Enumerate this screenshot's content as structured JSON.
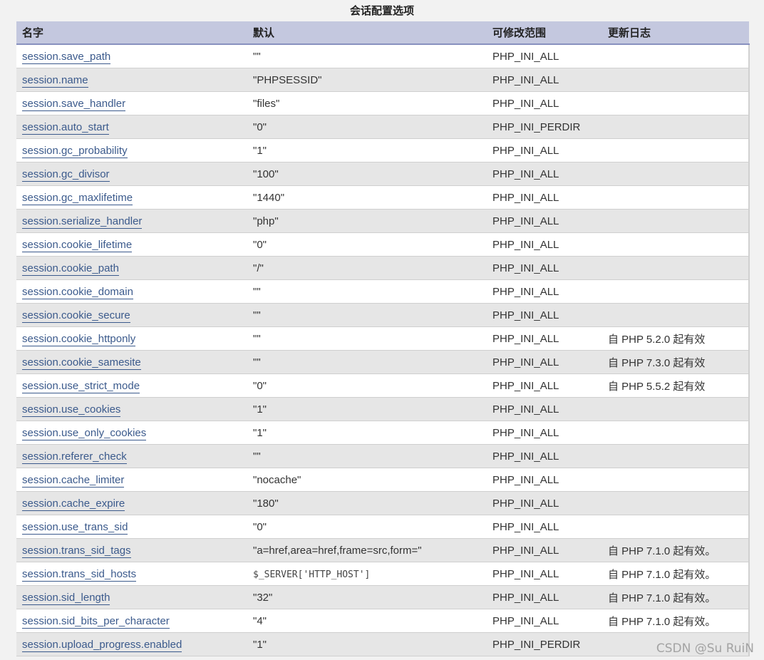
{
  "caption": "会话配置选项",
  "table": {
    "headers": [
      "名字",
      "默认",
      "可修改范围",
      "更新日志"
    ],
    "rows": [
      {
        "name": "session.save_path",
        "default": "\"\"",
        "scope": "PHP_INI_ALL",
        "changelog": ""
      },
      {
        "name": "session.name",
        "default": "\"PHPSESSID\"",
        "scope": "PHP_INI_ALL",
        "changelog": ""
      },
      {
        "name": "session.save_handler",
        "default": "\"files\"",
        "scope": "PHP_INI_ALL",
        "changelog": ""
      },
      {
        "name": "session.auto_start",
        "default": "\"0\"",
        "scope": "PHP_INI_PERDIR",
        "changelog": ""
      },
      {
        "name": "session.gc_probability",
        "default": "\"1\"",
        "scope": "PHP_INI_ALL",
        "changelog": ""
      },
      {
        "name": "session.gc_divisor",
        "default": "\"100\"",
        "scope": "PHP_INI_ALL",
        "changelog": ""
      },
      {
        "name": "session.gc_maxlifetime",
        "default": "\"1440\"",
        "scope": "PHP_INI_ALL",
        "changelog": ""
      },
      {
        "name": "session.serialize_handler",
        "default": "\"php\"",
        "scope": "PHP_INI_ALL",
        "changelog": ""
      },
      {
        "name": "session.cookie_lifetime",
        "default": "\"0\"",
        "scope": "PHP_INI_ALL",
        "changelog": ""
      },
      {
        "name": "session.cookie_path",
        "default": "\"/\"",
        "scope": "PHP_INI_ALL",
        "changelog": ""
      },
      {
        "name": "session.cookie_domain",
        "default": "\"\"",
        "scope": "PHP_INI_ALL",
        "changelog": ""
      },
      {
        "name": "session.cookie_secure",
        "default": "\"\"",
        "scope": "PHP_INI_ALL",
        "changelog": ""
      },
      {
        "name": "session.cookie_httponly",
        "default": "\"\"",
        "scope": "PHP_INI_ALL",
        "changelog": "自 PHP 5.2.0 起有效"
      },
      {
        "name": "session.cookie_samesite",
        "default": "\"\"",
        "scope": "PHP_INI_ALL",
        "changelog": "自 PHP 7.3.0 起有效"
      },
      {
        "name": "session.use_strict_mode",
        "default": "\"0\"",
        "scope": "PHP_INI_ALL",
        "changelog": "自 PHP 5.5.2 起有效"
      },
      {
        "name": "session.use_cookies",
        "default": "\"1\"",
        "scope": "PHP_INI_ALL",
        "changelog": ""
      },
      {
        "name": "session.use_only_cookies",
        "default": "\"1\"",
        "scope": "PHP_INI_ALL",
        "changelog": ""
      },
      {
        "name": "session.referer_check",
        "default": "\"\"",
        "scope": "PHP_INI_ALL",
        "changelog": ""
      },
      {
        "name": "session.cache_limiter",
        "default": "\"nocache\"",
        "scope": "PHP_INI_ALL",
        "changelog": ""
      },
      {
        "name": "session.cache_expire",
        "default": "\"180\"",
        "scope": "PHP_INI_ALL",
        "changelog": ""
      },
      {
        "name": "session.use_trans_sid",
        "default": "\"0\"",
        "scope": "PHP_INI_ALL",
        "changelog": ""
      },
      {
        "name": "session.trans_sid_tags",
        "default": "\"a=href,area=href,frame=src,form=\"",
        "scope": "PHP_INI_ALL",
        "changelog": "自 PHP 7.1.0 起有效。"
      },
      {
        "name": "session.trans_sid_hosts",
        "default": "$_SERVER['HTTP_HOST']",
        "default_mono": true,
        "scope": "PHP_INI_ALL",
        "changelog": "自 PHP 7.1.0 起有效。"
      },
      {
        "name": "session.sid_length",
        "default": "\"32\"",
        "scope": "PHP_INI_ALL",
        "changelog": "自 PHP 7.1.0 起有效。"
      },
      {
        "name": "session.sid_bits_per_character",
        "default": "\"4\"",
        "scope": "PHP_INI_ALL",
        "changelog": "自 PHP 7.1.0 起有效。"
      },
      {
        "name": "session.upload_progress.enabled",
        "default": "\"1\"",
        "scope": "PHP_INI_PERDIR",
        "changelog": ""
      }
    ]
  },
  "watermark": "CSDN @Su RuiN"
}
